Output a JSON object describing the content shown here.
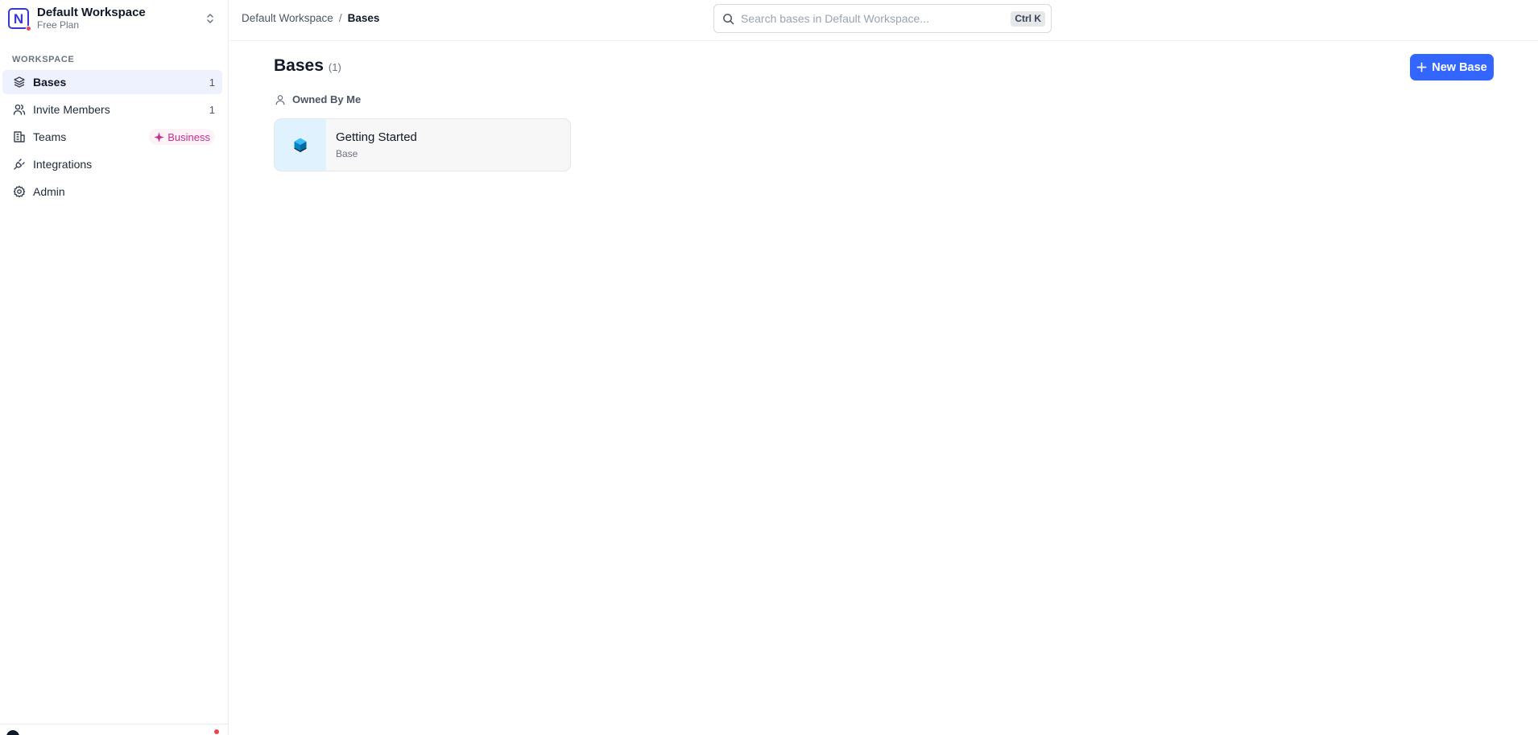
{
  "workspace": {
    "logo_letter": "N",
    "name": "Default Workspace",
    "plan": "Free Plan"
  },
  "sidebar": {
    "section_label": "WORKSPACE",
    "items": [
      {
        "label": "Bases",
        "count": "1",
        "icon": "layers-icon",
        "active": true
      },
      {
        "label": "Invite Members",
        "count": "1",
        "icon": "users-icon"
      },
      {
        "label": "Teams",
        "badge": "Business",
        "icon": "building-icon"
      },
      {
        "label": "Integrations",
        "icon": "plug-icon"
      },
      {
        "label": "Admin",
        "icon": "gear-icon"
      }
    ]
  },
  "breadcrumb": {
    "items": [
      "Default Workspace",
      "Bases"
    ],
    "separator": "/"
  },
  "search": {
    "placeholder": "Search bases in Default Workspace...",
    "shortcut": "Ctrl K"
  },
  "main": {
    "title": "Bases",
    "count": "(1)",
    "new_button_label": "New Base",
    "group_label": "Owned By Me",
    "bases": [
      {
        "title": "Getting Started",
        "subtitle": "Base"
      }
    ]
  },
  "colors": {
    "accent": "#3366ff",
    "logo": "#3a36d8",
    "active_bg": "#eef2ff",
    "business_badge": "#c5308a",
    "card_icon_bg": "#e0f2fe"
  }
}
